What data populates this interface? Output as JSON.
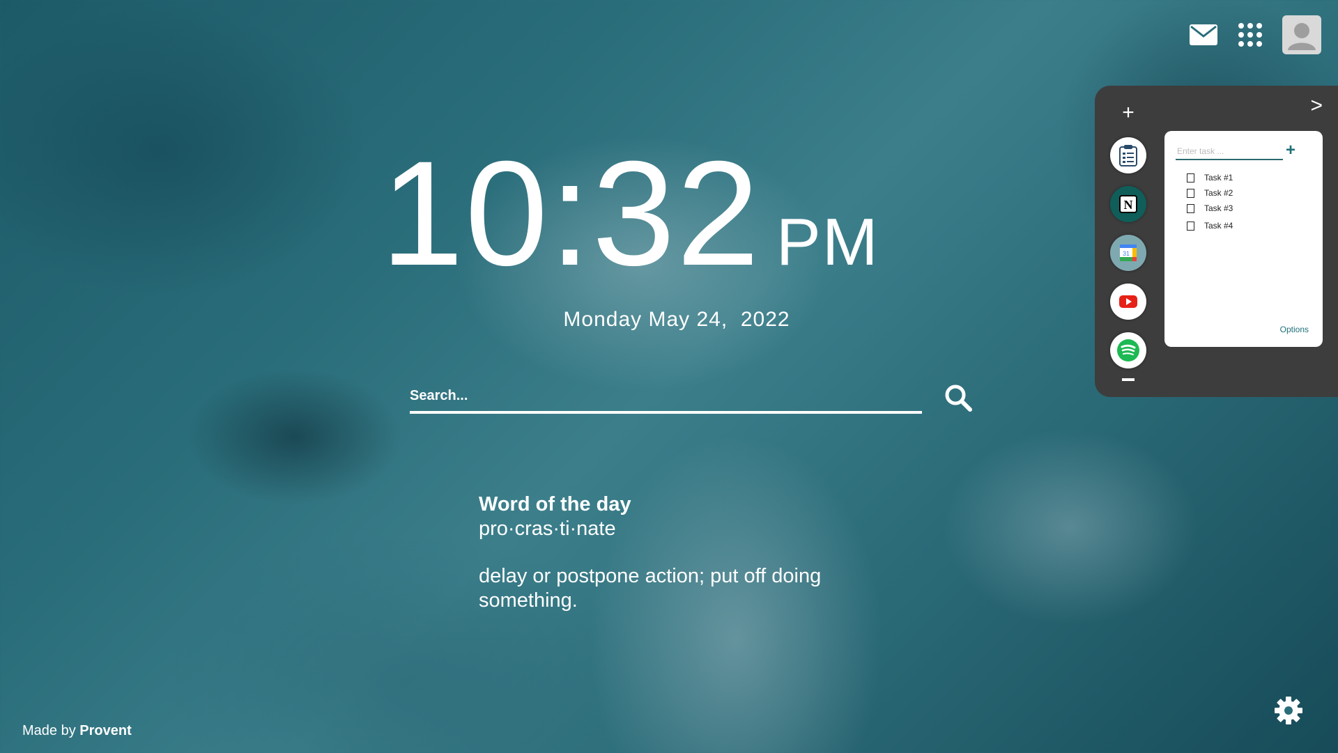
{
  "header": {
    "icons": [
      "mail-icon",
      "apps-grid-icon",
      "user-avatar-icon"
    ]
  },
  "clock": {
    "time": "10:32",
    "ampm": "PM",
    "date": "Monday May 24,  2022"
  },
  "search": {
    "placeholder": "Search...",
    "icon": "search-icon"
  },
  "word_of_day": {
    "title": "Word of the day",
    "word": "pro·cras·ti·nate",
    "definition": "delay or postpone action; put off doing something."
  },
  "footer": {
    "prefix": "Made by",
    "brand": "Provent"
  },
  "panel": {
    "next_label": ">",
    "add_label": "+",
    "apps": [
      "clipboard-tasks-icon",
      "notion-icon",
      "google-calendar-icon",
      "youtube-icon",
      "spotify-icon"
    ],
    "task_input_placeholder": "Enter task ...",
    "task_add_label": "+",
    "tasks": [
      "Task #1",
      "Task #2",
      "Task #3",
      "Task #4"
    ],
    "options_label": "Options"
  },
  "colors": {
    "accent": "#1f6f78",
    "panel_bg": "#3d3d3d",
    "youtube_red": "#e62117",
    "spotify_green": "#1db954"
  }
}
